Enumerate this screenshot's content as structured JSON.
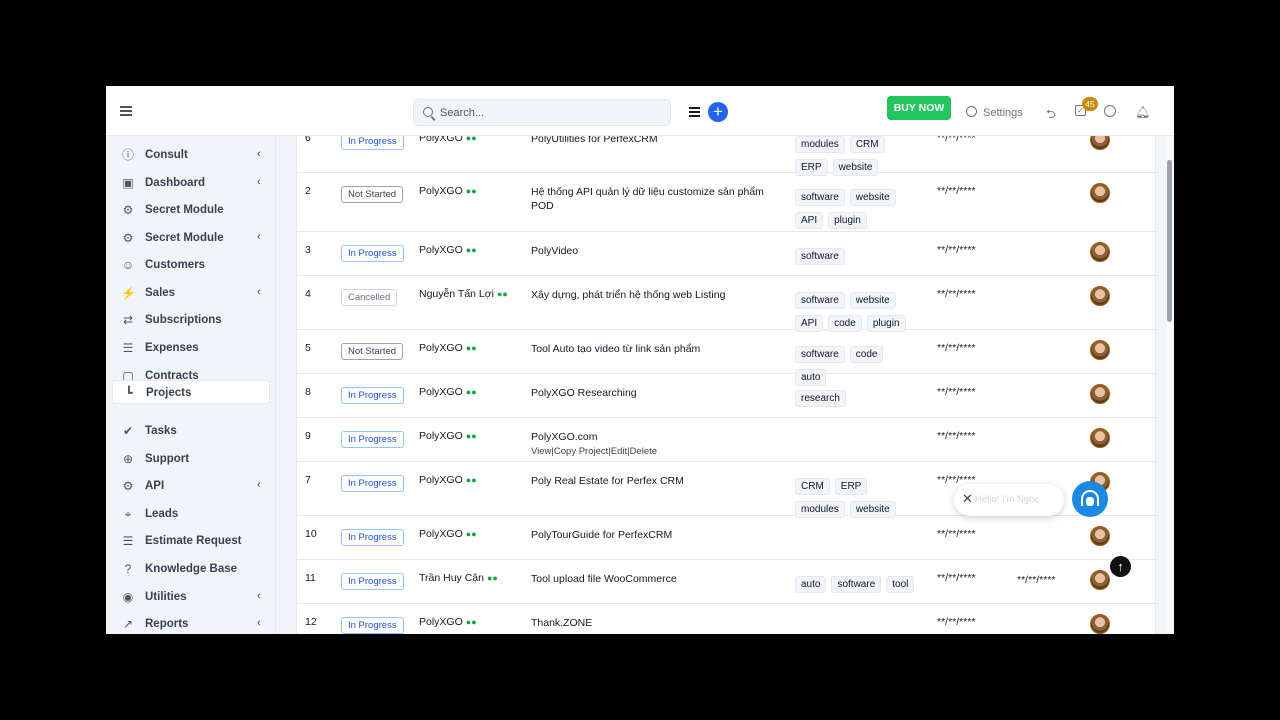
{
  "header": {
    "search_placeholder": "Search...",
    "buy_label": "BUY NOW",
    "settings_label": "Settings",
    "tasks_badge": "45"
  },
  "sidebar": {
    "items": [
      {
        "label": "Consult",
        "icon": "info-icon",
        "chevron": true
      },
      {
        "label": "Dashboard",
        "icon": "dashboard-icon",
        "chevron": true
      },
      {
        "label": "Secret Module",
        "icon": "cogs-icon",
        "chevron": false
      },
      {
        "label": "Secret Module",
        "icon": "cogs-icon",
        "chevron": true
      },
      {
        "label": "Customers",
        "icon": "user-icon",
        "chevron": false
      },
      {
        "label": "Sales",
        "icon": "bolt-icon",
        "chevron": true
      },
      {
        "label": "Subscriptions",
        "icon": "refresh-icon",
        "chevron": false
      },
      {
        "label": "Expenses",
        "icon": "file-icon",
        "chevron": false
      },
      {
        "label": "Contracts",
        "icon": "contract-icon",
        "chevron": false
      },
      {
        "label": "Projects",
        "icon": "chart-icon",
        "chevron": false,
        "active": true
      },
      {
        "label": "Tasks",
        "icon": "check-circle-icon",
        "chevron": false
      },
      {
        "label": "Support",
        "icon": "lifebuoy-icon",
        "chevron": false
      },
      {
        "label": "API",
        "icon": "cogs-icon",
        "chevron": true
      },
      {
        "label": "Leads",
        "icon": "crosshair-icon",
        "chevron": false
      },
      {
        "label": "Estimate Request",
        "icon": "file-icon",
        "chevron": false
      },
      {
        "label": "Knowledge Base",
        "icon": "question-icon",
        "chevron": false
      },
      {
        "label": "Utilities",
        "icon": "circle-dot-icon",
        "chevron": true
      },
      {
        "label": "Reports",
        "icon": "line-chart-icon",
        "chevron": true
      }
    ]
  },
  "projects": {
    "rows": [
      {
        "id": "6",
        "status": "In Progress",
        "status_type": "progress",
        "customer": "PolyXGO",
        "name": "PolyUtilities for PerfexCRM",
        "tags": [
          "modules",
          "CRM",
          "ERP",
          "website"
        ],
        "start": "**/**/****",
        "deadline": "",
        "actions": ""
      },
      {
        "id": "2",
        "status": "Not Started",
        "status_type": "notstarted",
        "customer": "PolyXGO",
        "name": "Hệ thống API quản lý dữ liệu customize sản phẩm POD",
        "tags": [
          "software",
          "website",
          "API",
          "plugin"
        ],
        "start": "**/**/****",
        "deadline": "",
        "actions": ""
      },
      {
        "id": "3",
        "status": "In Progress",
        "status_type": "progress",
        "customer": "PolyXGO",
        "name": "PolyVideo",
        "tags": [
          "software"
        ],
        "start": "**/**/****",
        "deadline": "",
        "actions": ""
      },
      {
        "id": "4",
        "status": "Cancelled",
        "status_type": "cancelled",
        "customer": "Nguyễn Tấn Lợi",
        "name": "Xây dựng, phát triển hệ thống web Listing",
        "tags": [
          "software",
          "website",
          "API",
          "code",
          "plugin"
        ],
        "start": "**/**/****",
        "deadline": "",
        "actions": ""
      },
      {
        "id": "5",
        "status": "Not Started",
        "status_type": "notstarted",
        "customer": "PolyXGO",
        "name": "Tool Auto tạo video từ link sản phẩm",
        "tags": [
          "software",
          "code",
          "auto"
        ],
        "start": "**/**/****",
        "deadline": "",
        "actions": ""
      },
      {
        "id": "8",
        "status": "In Progress",
        "status_type": "progress",
        "customer": "PolyXGO",
        "name": "PolyXGO Researching",
        "tags": [
          "research"
        ],
        "start": "**/**/****",
        "deadline": "",
        "actions": ""
      },
      {
        "id": "9",
        "status": "In Progress",
        "status_type": "progress",
        "customer": "PolyXGO",
        "name": "PolyXGO.com",
        "tags": [],
        "start": "**/**/****",
        "deadline": "",
        "actions": "View|Copy Project|Edit|Delete"
      },
      {
        "id": "7",
        "status": "In Progress",
        "status_type": "progress",
        "customer": "PolyXGO",
        "name": "Poly Real Estate for Perfex CRM",
        "tags": [
          "CRM",
          "ERP",
          "modules",
          "website"
        ],
        "start": "**/**/****",
        "deadline": "",
        "actions": ""
      },
      {
        "id": "10",
        "status": "In Progress",
        "status_type": "progress",
        "customer": "PolyXGO",
        "name": "PolyTourGuide for PerfexCRM",
        "tags": [],
        "start": "**/**/****",
        "deadline": "",
        "actions": ""
      },
      {
        "id": "11",
        "status": "In Progress",
        "status_type": "progress",
        "customer": "Trần Huy Cận",
        "name": "Tool upload file WooCommerce",
        "tags": [
          "auto",
          "software",
          "tool"
        ],
        "start": "**/**/****",
        "deadline": "**/**/****",
        "actions": ""
      },
      {
        "id": "12",
        "status": "In Progress",
        "status_type": "progress",
        "customer": "PolyXGO",
        "name": "Thank.ZONE",
        "tags": [],
        "start": "**/**/****",
        "deadline": "",
        "actions": ""
      }
    ]
  },
  "chat": {
    "message": "Hello! I'm Ngoc"
  }
}
